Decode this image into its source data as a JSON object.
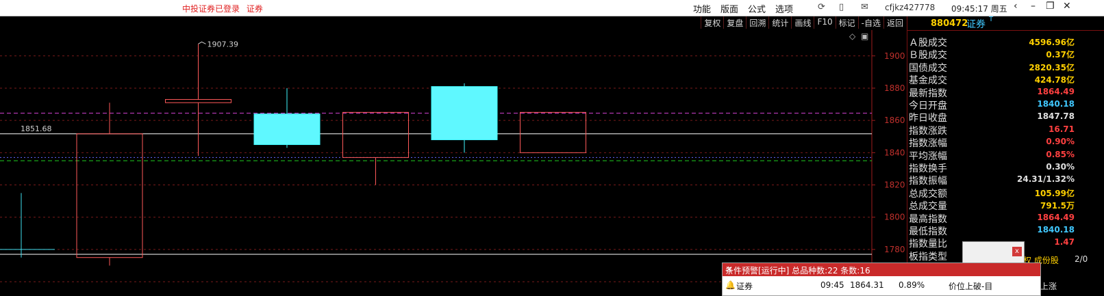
{
  "titlebar": {
    "status": [
      "中投证券已登录",
      "证券"
    ],
    "menu": [
      "功能",
      "版面",
      "公式",
      "选项"
    ],
    "account": "cfjkz427778",
    "clock": "09:45:17 周五",
    "icons": [
      "refresh-icon",
      "phone-icon",
      "mail-icon",
      "back-icon",
      "minimize-icon",
      "restore-icon",
      "close-icon"
    ]
  },
  "chart_toolbar": [
    "复权",
    "复盘",
    "回溯",
    "统计",
    "画线",
    "F10",
    "标记",
    "-自选",
    "返回"
  ],
  "chart_data": {
    "type": "candlestick",
    "title": "",
    "y_ticks": [
      1760,
      1780,
      1800,
      1820,
      1840,
      1860,
      1880,
      1900
    ],
    "ylim": [
      1752,
      1916
    ],
    "candles": [
      {
        "open": 1851.68,
        "high": 1871,
        "low": 1770,
        "close": 1775,
        "style": "hollow-red"
      },
      {
        "open": 1871,
        "high": 1907.39,
        "low": 1838,
        "close": 1873,
        "style": "hollow-red"
      },
      {
        "open": 1845,
        "high": 1880,
        "low": 1843,
        "close": 1864,
        "style": "cyan"
      },
      {
        "open": 1837,
        "high": 1865,
        "low": 1820,
        "close": 1865,
        "style": "hollow-red"
      },
      {
        "open": 1881,
        "high": 1883,
        "low": 1840,
        "close": 1848,
        "style": "cyan"
      },
      {
        "open": 1840,
        "high": 1865,
        "low": 1840,
        "close": 1865,
        "style": "hollow-red"
      }
    ],
    "partial_left_bar": {
      "high": 1815,
      "low": 1775,
      "tick": 1780
    },
    "annotations": [
      {
        "label": "1907.39",
        "value": 1907.39
      },
      {
        "label": "1851.68",
        "value": 1851.68
      }
    ],
    "reference_lines": [
      {
        "value": 1851.68,
        "color": "#ffffff",
        "style": "solid"
      },
      {
        "value": 1777,
        "color": "#ffffff",
        "style": "solid"
      },
      {
        "value": 1864.49,
        "color": "#d040d0",
        "style": "dashed"
      },
      {
        "value": 1837,
        "color": "#6a6aff",
        "style": "dotted"
      },
      {
        "value": 1835,
        "color": "#20d020",
        "style": "dashed"
      }
    ],
    "grid": true
  },
  "panel": {
    "code": "880472",
    "name": "证券",
    "mark": "T",
    "stats": [
      {
        "label": "Ａ股成交",
        "value": "4596.96亿",
        "color": "#ffd000"
      },
      {
        "label": "Ｂ股成交",
        "value": "0.37亿",
        "color": "#ffd000"
      },
      {
        "label": "国债成交",
        "value": "2820.35亿",
        "color": "#ffd000"
      },
      {
        "label": "基金成交",
        "value": "424.78亿",
        "color": "#ffd000"
      },
      {
        "label": "最新指数",
        "value": "1864.49",
        "color": "#ff4040"
      },
      {
        "label": "今日开盘",
        "value": "1840.18",
        "color": "#40c8ff"
      },
      {
        "label": "昨日收盘",
        "value": "1847.78",
        "color": "#e0e0e0"
      },
      {
        "label": "指数涨跌",
        "value": "16.71",
        "color": "#ff4040"
      },
      {
        "label": "指数涨幅",
        "value": "0.90%",
        "color": "#ff4040"
      },
      {
        "label": "平均涨幅",
        "value": "0.85%",
        "color": "#ff4040"
      },
      {
        "label": "指数换手",
        "value": "0.30%",
        "color": "#e0e0e0"
      },
      {
        "label": "指数振幅",
        "value": "24.31/1.32%",
        "color": "#e0e0e0"
      },
      {
        "label": "总成交额",
        "value": "105.99亿",
        "color": "#ffd000"
      },
      {
        "label": "总成交量",
        "value": "791.5万",
        "color": "#ffd000"
      },
      {
        "label": "最高指数",
        "value": "1864.49",
        "color": "#ff4040"
      },
      {
        "label": "最低指数",
        "value": "1840.18",
        "color": "#40c8ff"
      },
      {
        "label": "指数量比",
        "value": "1.47",
        "color": "#ff4040"
      },
      {
        "label": "板指类型",
        "value": "",
        "color": "#e0e0e0"
      }
    ],
    "peek_left": "权 成份股",
    "peek_right": "2/0"
  },
  "popup_small": {
    "close": "x"
  },
  "alert": {
    "title": "条件预警[运行中] 总品种数:22 条数:16",
    "close": "×",
    "row": {
      "name": "证券",
      "time": "09:45",
      "price": "1864.31",
      "pct": "0.89%",
      "condition": "价位上破-目"
    },
    "fragment": "上涨"
  }
}
